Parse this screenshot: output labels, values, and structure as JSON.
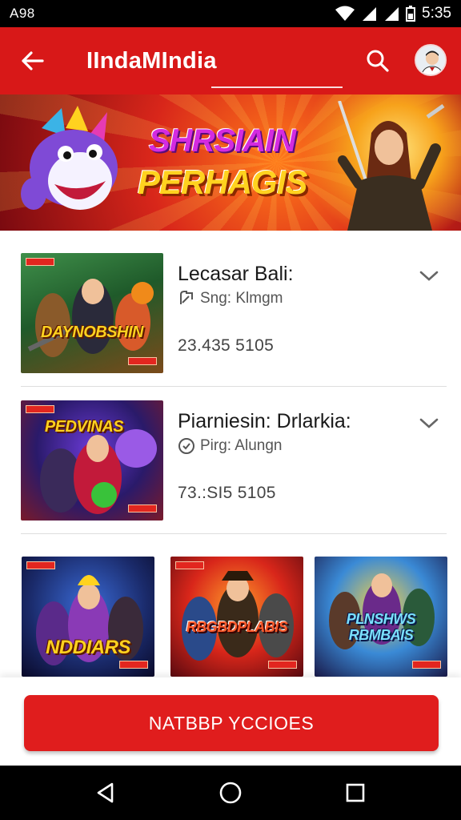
{
  "status_bar": {
    "left_text": "A98",
    "time": "5:35"
  },
  "app_bar": {
    "title": "IIndaMIndia"
  },
  "banner": {
    "title_line1": "SHRSIAIN",
    "title_line2": "PERHAGIS"
  },
  "list": [
    {
      "name": "Lecasar Bali:",
      "meta": "Sng: Klmgm",
      "stats": "23.435 5105",
      "thumb_label": "DAYNOBSHIN",
      "meta_icon": "link-icon"
    },
    {
      "name": "Piarniesin: Drlarkia:",
      "meta": "Pirg: Alungn",
      "stats": "73.:SI5 5105",
      "thumb_label": "PEDVINAS",
      "meta_icon": "clock-icon"
    }
  ],
  "grid": [
    {
      "label": "NDDIARS"
    },
    {
      "label": "RBGBDPLABIS"
    },
    {
      "label": "PLNSHWS RBMBAIS"
    }
  ],
  "cta": {
    "label": "NATBBP YCCIOES"
  },
  "colors": {
    "brand_red": "#d81818",
    "cta_red": "#e01d1d"
  }
}
